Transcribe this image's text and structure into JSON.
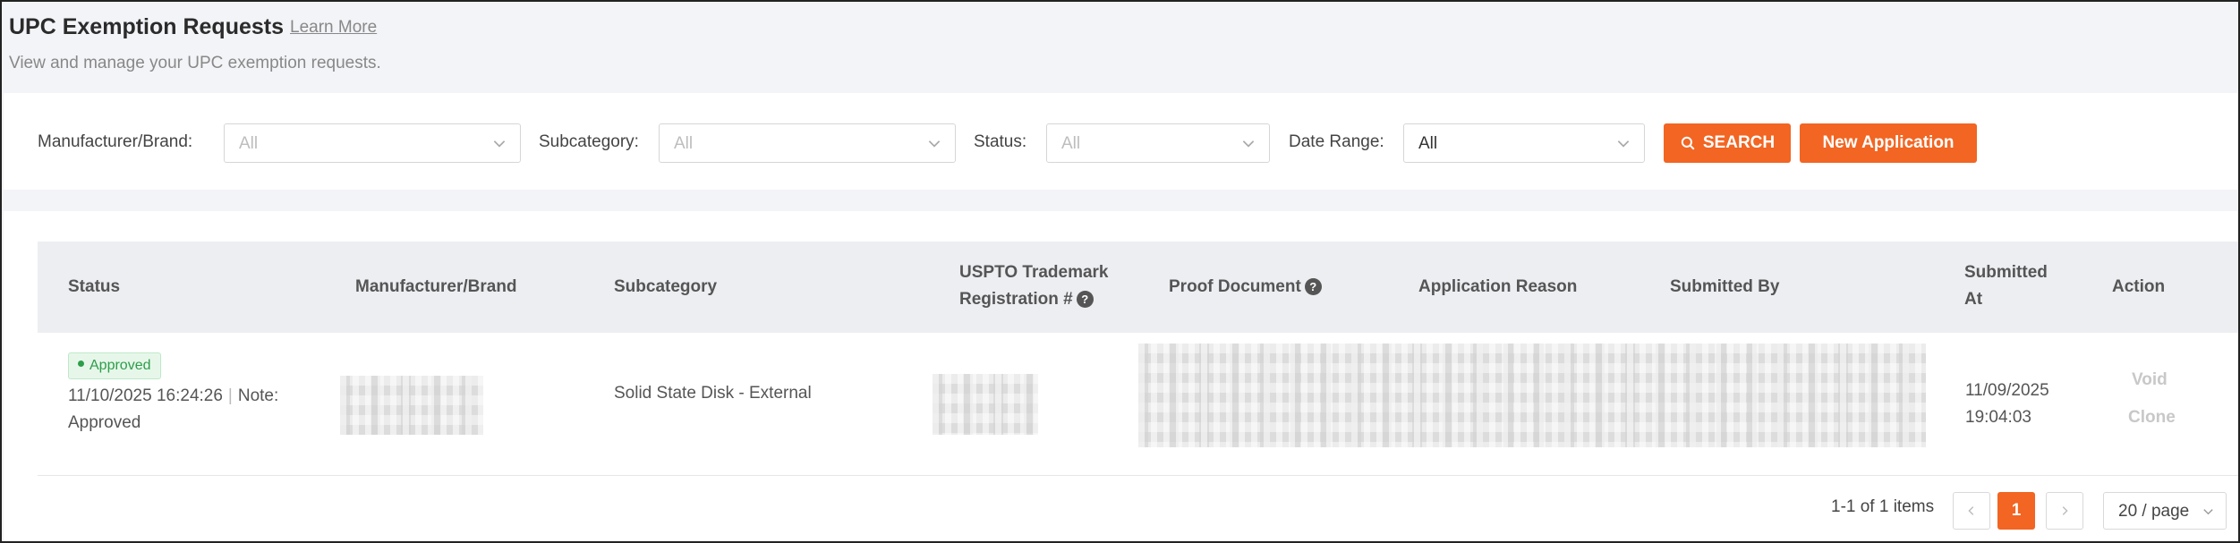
{
  "header": {
    "title": "UPC Exemption Requests",
    "learn_more": "Learn More",
    "subtitle": "View and manage your UPC exemption requests."
  },
  "filters": {
    "manufacturer_label": "Manufacturer/Brand:",
    "manufacturer_value": "All",
    "subcategory_label": "Subcategory:",
    "subcategory_value": "All",
    "status_label": "Status:",
    "status_value": "All",
    "date_range_label": "Date Range:",
    "date_range_value": "All",
    "search_label": "SEARCH",
    "new_application_label": "New Application"
  },
  "table": {
    "columns": {
      "status": "Status",
      "manufacturer": "Manufacturer/Brand",
      "subcategory": "Subcategory",
      "uspto_line1": "USPTO Trademark",
      "uspto_line2": "Registration #",
      "proof_document": "Proof Document",
      "application_reason": "Application Reason",
      "submitted_by": "Submitted By",
      "submitted_at_line1": "Submitted",
      "submitted_at_line2": "At",
      "action": "Action"
    },
    "rows": [
      {
        "status": "Approved",
        "status_time": "11/10/2025 16:24:26",
        "note_label": "Note:",
        "note_value": "Approved",
        "subcategory": "Solid State Disk - External",
        "submitted_date": "11/09/2025",
        "submitted_time": "19:04:03",
        "actions": [
          "Void",
          "Clone"
        ]
      }
    ]
  },
  "pagination": {
    "total_text": "1-1 of 1 items",
    "current_page": "1",
    "page_size": "20 / page"
  },
  "colors": {
    "accent": "#f26522",
    "approved": "#2e9d4a"
  }
}
